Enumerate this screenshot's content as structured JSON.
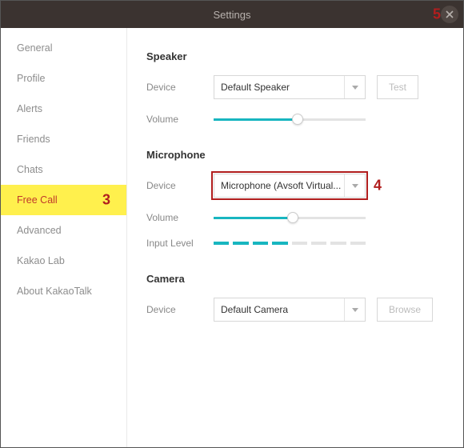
{
  "title": "Settings",
  "annotations": {
    "close": "5",
    "sidebar": "3",
    "micSelect": "4"
  },
  "sidebar": {
    "items": [
      {
        "label": "General"
      },
      {
        "label": "Profile"
      },
      {
        "label": "Alerts"
      },
      {
        "label": "Friends"
      },
      {
        "label": "Chats"
      },
      {
        "label": "Free Call"
      },
      {
        "label": "Advanced"
      },
      {
        "label": "Kakao Lab"
      },
      {
        "label": "About KakaoTalk"
      }
    ],
    "activeIndex": 5
  },
  "speaker": {
    "title": "Speaker",
    "deviceLabel": "Device",
    "device": "Default Speaker",
    "testLabel": "Test",
    "volumeLabel": "Volume",
    "volume": 55
  },
  "microphone": {
    "title": "Microphone",
    "deviceLabel": "Device",
    "device": "Microphone (Avsoft Virtual...",
    "volumeLabel": "Volume",
    "volume": 52,
    "levelLabel": "Input Level",
    "levelSegments": 8,
    "levelActive": 4
  },
  "camera": {
    "title": "Camera",
    "deviceLabel": "Device",
    "device": "Default Camera",
    "browseLabel": "Browse"
  }
}
